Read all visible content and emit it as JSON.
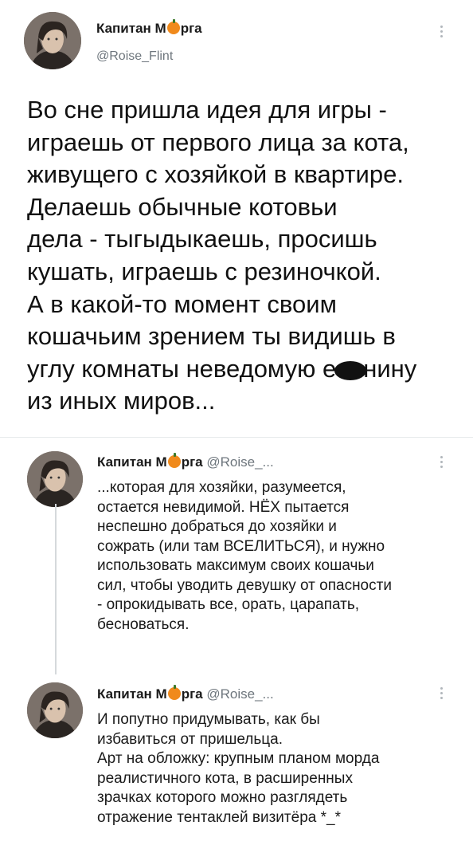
{
  "main_tweet": {
    "author_name_pre": "Капитан М",
    "author_name_post": "рга",
    "handle": "@Roise_Flint",
    "text_lines": [
      "Во сне пришла идея для игры -",
      "играешь от первого лица за кота,",
      "живущего с хозяйкой в квартире.",
      "Делаешь обычные котовьи",
      "дела - тыгыдыкаешь, просишь",
      "кушать, играешь с резиночкой.",
      "А в какой-то момент своим",
      "кошачьим зрением ты видишь в"
    ],
    "line9_pre": "углу комнаты неведомую е",
    "line9_post": "нину",
    "line10": "из иных миров..."
  },
  "reply1": {
    "author_name_pre": "Капитан М",
    "author_name_post": "рга",
    "handle": "@Roise_...",
    "text_lines": [
      "...которая для хозяйки, разумеется,",
      "остается невидимой. НЁХ пытается",
      "неспешно добраться до хозяйки и",
      "сожрать (или там ВСЕЛИТЬСЯ), и нужно",
      "использовать максимум своих кошачьи",
      "сил, чтобы уводить девушку от опасности",
      "- опрокидывать все, орать, царапать,",
      "бесноваться."
    ]
  },
  "reply2": {
    "author_name_pre": "Капитан М",
    "author_name_post": "рга",
    "handle": "@Roise_...",
    "text_lines": [
      "И попутно придумывать, как бы",
      "избавиться от пришельца.",
      "Арт на обложку: крупным планом морда",
      "реалистичного кота, в расширенных",
      "зрачках которого можно разглядеть",
      "отражение тентаклей визитёра *_*"
    ]
  },
  "icons": [
    "avatar",
    "pumpkin-emoji-icon",
    "more-options-icon"
  ],
  "colors": {
    "handle": "#6e767d",
    "pumpkin": "#f08a1c",
    "thread_line": "#d5d9dc"
  }
}
